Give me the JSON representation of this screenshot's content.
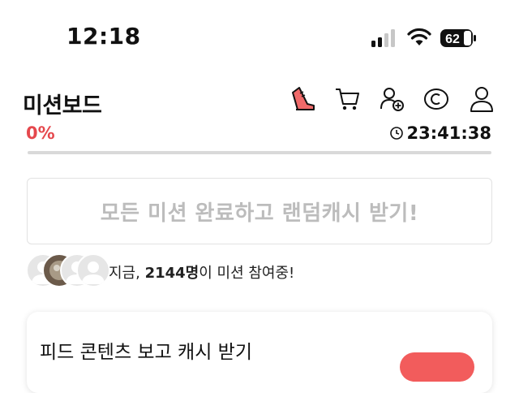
{
  "status_bar": {
    "time": "12:18",
    "battery_level": "62"
  },
  "header": {
    "title": "미션보드",
    "icons": [
      "sneaker-icon",
      "cart-icon",
      "add-friend-icon",
      "coin-icon",
      "profile-icon"
    ]
  },
  "progress": {
    "percent_label": "0%",
    "value": 0,
    "timer": "23:41:38"
  },
  "reward_button": {
    "label": "모든 미션 완료하고 랜덤캐시 받기!"
  },
  "participants": {
    "prefix": "지금, ",
    "count": "2144명",
    "suffix": "이 미션 참여중!"
  },
  "mission_card": {
    "title": "피드 콘텐츠 보고 캐시 받기"
  },
  "colors": {
    "accent": "#e5484d",
    "disabled_text": "#bcbcbc",
    "track": "#d9d9d9"
  }
}
